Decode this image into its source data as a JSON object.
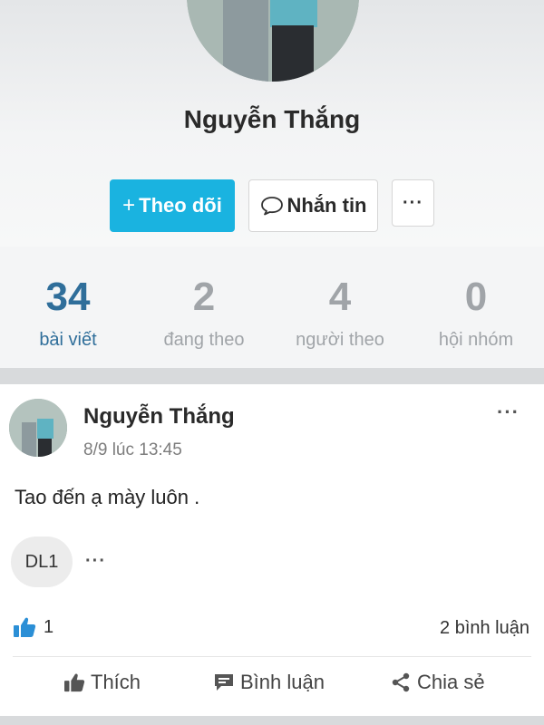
{
  "profile": {
    "name": "Nguyễn Thắng",
    "follow_plus": "+",
    "follow_label": "Theo dõi",
    "message_label": "Nhắn tin",
    "more_label": "···"
  },
  "stats": [
    {
      "value": "34",
      "label": "bài viết"
    },
    {
      "value": "2",
      "label": "đang theo"
    },
    {
      "value": "4",
      "label": "người theo"
    },
    {
      "value": "0",
      "label": "hội nhóm"
    }
  ],
  "post": {
    "author": "Nguyễn Thắng",
    "time": "8/9 lúc 13:45",
    "menu": "···",
    "content": "Tao đến ạ mày luôn .",
    "tag": "DL1",
    "tag_more": "···",
    "likes": "1",
    "comments": "2 bình luận",
    "actions": {
      "like": "Thích",
      "comment": "Bình luận",
      "share": "Chia sẻ"
    }
  },
  "colors": {
    "accent": "#1ab3e0",
    "active_stat": "#2f6e9a",
    "like_icon": "#2b8fd6"
  },
  "icons": {
    "message": "chat-bubble-icon",
    "like_count": "thumbs-up-icon",
    "action_like": "thumbs-up-icon",
    "action_comment": "comment-icon",
    "action_share": "share-icon"
  }
}
